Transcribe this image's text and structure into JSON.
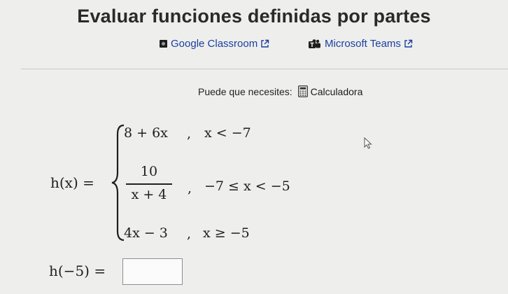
{
  "title": "Evaluar funciones deﬁnidas por partes",
  "share": {
    "classroom_label": "Google Classroom",
    "classroom_icon": "google-classroom-icon",
    "teams_label": "Microsoft Teams",
    "teams_icon": "microsoft-teams-icon",
    "external_icon": "external-link-icon"
  },
  "tools": {
    "prefix": "Puede que necesites:",
    "calculator_label": "Calculadora",
    "calculator_icon": "calculator-icon"
  },
  "function": {
    "label": "h(x) =",
    "pieces": [
      {
        "expr": "8 + 6x",
        "comma": ",",
        "condition": "x < −7"
      },
      {
        "numerator": "10",
        "denominator": "x + 4",
        "comma": ",",
        "condition": "−7 ≤ x < −5"
      },
      {
        "expr": "4x − 3",
        "comma": ",",
        "condition": "x ≥ −5"
      }
    ]
  },
  "question": {
    "label": "h(−5) =",
    "answer_value": ""
  },
  "colors": {
    "background": "#eeeeec",
    "link": "#1a3fa0",
    "text": "#1f1f1f"
  }
}
